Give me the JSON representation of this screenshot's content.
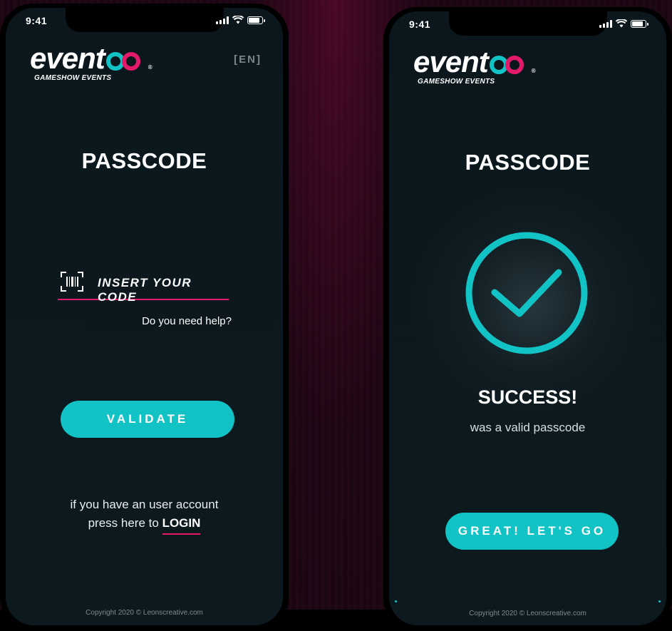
{
  "colors": {
    "accent": "#12c3c6",
    "brand_magenta": "#e3196b",
    "screen_bg": "#0b171c"
  },
  "left_phone": {
    "status": {
      "time": "9:41"
    },
    "logo": {
      "word": "event",
      "subtitle": "GAMESHOW EVENTS",
      "reg": "®"
    },
    "language": "[EN]",
    "title": "PASSCODE",
    "code_input": {
      "placeholder": "INSERT YOUR CODE",
      "icon": "barcode-scan-icon"
    },
    "help_link": "Do you need help?",
    "validate_button": "VALIDATE",
    "login_prompt": {
      "line1": "if you have an user account",
      "line2_prefix": "press here to",
      "link": "LOGIN"
    },
    "copyright": "Copyright 2020 © Leonscreative.com"
  },
  "right_phone": {
    "status": {
      "time": "9:41"
    },
    "logo": {
      "word": "event",
      "subtitle": "GAMESHOW EVENTS",
      "reg": "®"
    },
    "title": "PASSCODE",
    "status_icon": "checkmark-circle-icon",
    "success_title": "SUCCESS!",
    "success_message": "was a valid passcode",
    "go_button": "GREAT! LET'S GO",
    "copyright": "Copyright 2020 © Leonscreative.com"
  }
}
